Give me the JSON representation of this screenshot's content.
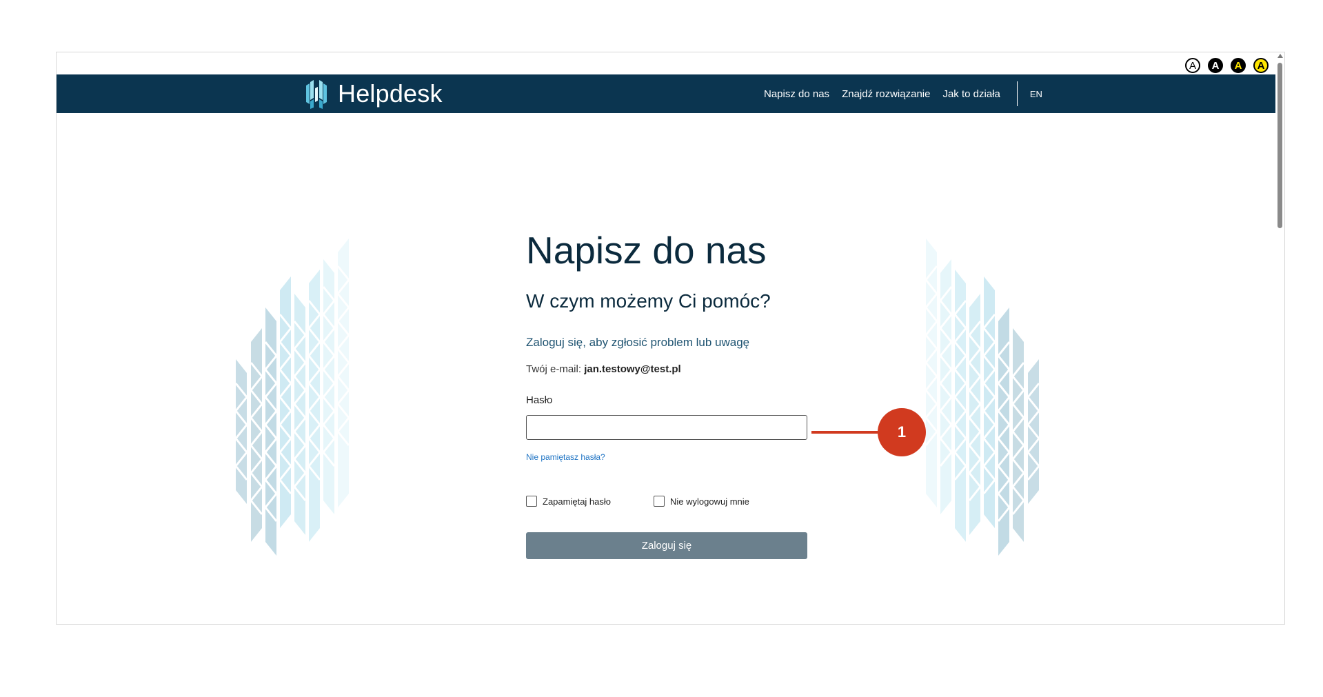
{
  "accessibility": {
    "contrast_buttons": [
      "A",
      "A",
      "A",
      "A"
    ]
  },
  "header": {
    "brand": "Helpdesk",
    "nav": [
      "Napisz do nas",
      "Znajdź rozwiązanie",
      "Jak to działa"
    ],
    "lang": "EN"
  },
  "main": {
    "title": "Napisz do nas",
    "subtitle": "W czym możemy Ci pomóc?",
    "info": "Zaloguj się, aby zgłosić problem lub uwagę",
    "email_label": "Twój e-mail:",
    "email_value": "jan.testowy@test.pl",
    "password_label": "Hasło",
    "password_value": "",
    "forgot": "Nie pamiętasz hasła?",
    "remember_label": "Zapamiętaj hasło",
    "stay_logged_label": "Nie wylogowuj mnie",
    "login_button": "Zaloguj się"
  },
  "annotation": {
    "number": "1"
  },
  "colors": {
    "navbar": "#0b3550",
    "button": "#6b808d",
    "callout": "#d13a1f",
    "link": "#1f74c4"
  }
}
